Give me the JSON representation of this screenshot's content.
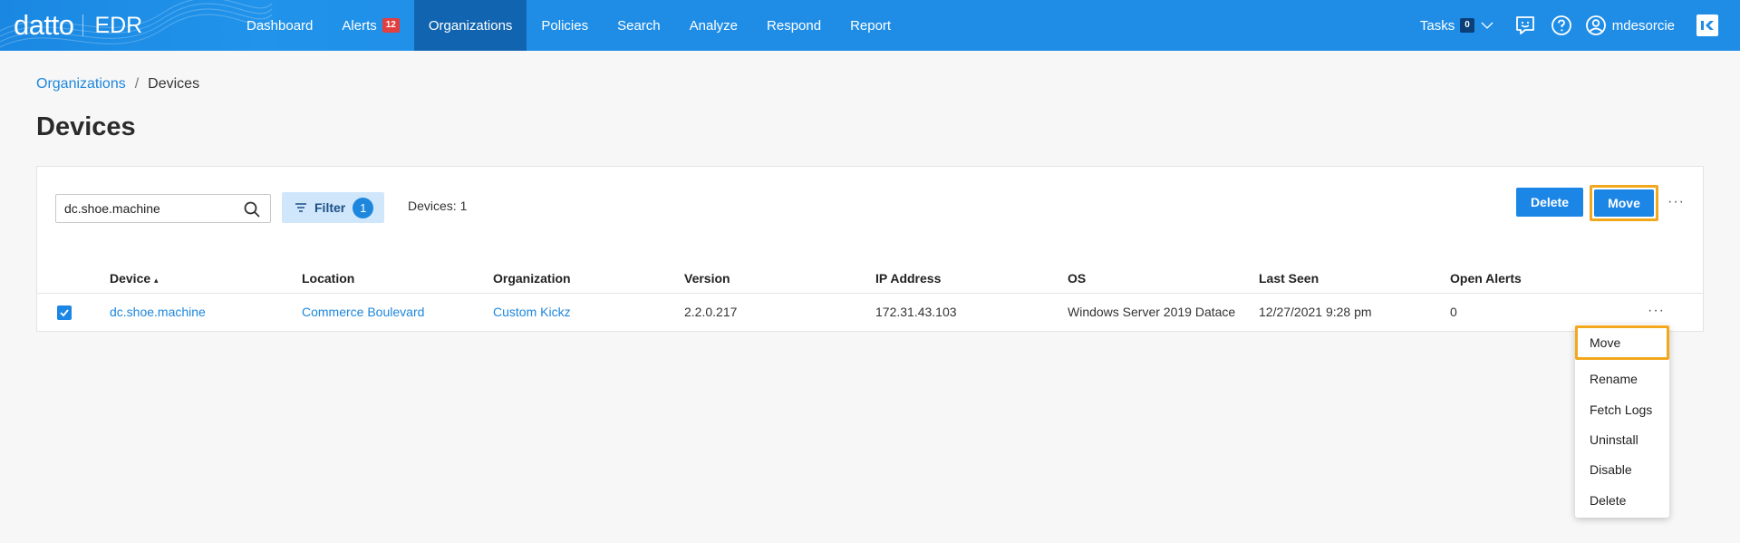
{
  "brand": {
    "logo": "datto",
    "product": "EDR"
  },
  "nav": {
    "items": [
      {
        "label": "Dashboard",
        "badge": null
      },
      {
        "label": "Alerts",
        "badge": "12"
      },
      {
        "label": "Organizations",
        "badge": null
      },
      {
        "label": "Policies",
        "badge": null
      },
      {
        "label": "Search",
        "badge": null
      },
      {
        "label": "Analyze",
        "badge": null
      },
      {
        "label": "Respond",
        "badge": null
      },
      {
        "label": "Report",
        "badge": null
      }
    ],
    "active": "Organizations",
    "tasks_label": "Tasks",
    "tasks_count": "0",
    "username": "mdesorcie"
  },
  "breadcrumb": {
    "parent": "Organizations",
    "separator": "/",
    "current": "Devices"
  },
  "page_title": "Devices",
  "toolbar": {
    "search_value": "dc.shoe.machine",
    "filter_label": "Filter",
    "filter_count": "1",
    "devices_count": "Devices: 1",
    "delete_label": "Delete",
    "move_label": "Move"
  },
  "table": {
    "columns": [
      "Device",
      "Location",
      "Organization",
      "Version",
      "IP Address",
      "OS",
      "Last Seen",
      "Open Alerts"
    ],
    "sort_indicator": "▴",
    "rows": [
      {
        "device": "dc.shoe.machine",
        "location": "Commerce Boulevard",
        "organization": "Custom Kickz",
        "version": "2.2.0.217",
        "ip": "172.31.43.103",
        "os": "Windows Server 2019 Datace",
        "last_seen": "12/27/2021 9:28 pm",
        "open_alerts": "0",
        "selected": true
      }
    ]
  },
  "row_menu": {
    "items": [
      "Move",
      "Rename",
      "Fetch Logs",
      "Uninstall",
      "Disable",
      "Delete"
    ]
  },
  "colors": {
    "nav_bg": "#1f8de6",
    "nav_active": "#1165b0",
    "primary": "#1c86e6",
    "link": "#1d87dd",
    "highlight": "#f2a81d",
    "alert_badge": "#e23f3f"
  }
}
